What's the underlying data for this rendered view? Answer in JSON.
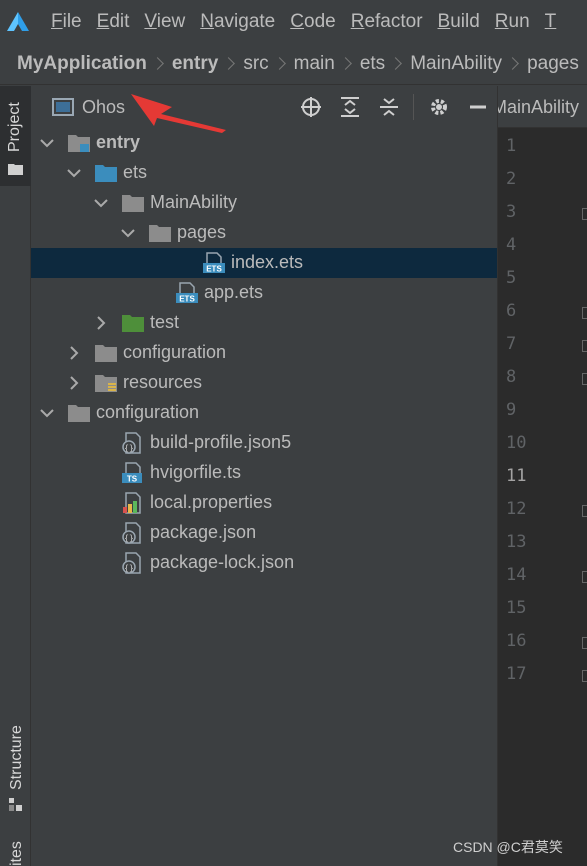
{
  "menu": {
    "items": [
      {
        "mnemonic": "F",
        "rest": "ile"
      },
      {
        "mnemonic": "E",
        "rest": "dit"
      },
      {
        "mnemonic": "V",
        "rest": "iew"
      },
      {
        "mnemonic": "N",
        "rest": "avigate"
      },
      {
        "mnemonic": "C",
        "rest": "ode"
      },
      {
        "mnemonic": "R",
        "rest": "efactor"
      },
      {
        "mnemonic": "B",
        "rest": "uild"
      },
      {
        "mnemonic": "R",
        "rest": "un"
      },
      {
        "mnemonic": "T",
        "rest": ""
      }
    ]
  },
  "breadcrumb": {
    "items": [
      "MyApplication",
      "entry",
      "src",
      "main",
      "ets",
      "MainAbility",
      "pages"
    ]
  },
  "left_strip": {
    "project_tab": "Project",
    "structure_tab": "Structure",
    "bottom_tab": "ites"
  },
  "panel": {
    "title": "Ohos"
  },
  "tree": [
    {
      "label": "entry",
      "icon": "module-folder-icon",
      "expanded": true
    },
    {
      "label": "ets",
      "icon": "source-folder-icon",
      "expanded": true
    },
    {
      "label": "MainAbility",
      "icon": "folder-icon",
      "expanded": true
    },
    {
      "label": "pages",
      "icon": "folder-icon",
      "expanded": true
    },
    {
      "label": "index.ets",
      "icon": "ets-file-icon",
      "selected": true
    },
    {
      "label": "app.ets",
      "icon": "ets-file-icon"
    },
    {
      "label": "test",
      "icon": "test-folder-icon",
      "expanded": false
    },
    {
      "label": "configuration",
      "icon": "folder-icon",
      "expanded": false
    },
    {
      "label": "resources",
      "icon": "resources-folder-icon",
      "expanded": false
    },
    {
      "label": "configuration",
      "icon": "folder-icon",
      "expanded": true
    },
    {
      "label": "build-profile.json5",
      "icon": "json-file-icon"
    },
    {
      "label": "hvigorfile.ts",
      "icon": "ts-file-icon"
    },
    {
      "label": "local.properties",
      "icon": "properties-file-icon"
    },
    {
      "label": "package.json",
      "icon": "json-file-icon"
    },
    {
      "label": "package-lock.json",
      "icon": "json-file-icon"
    }
  ],
  "editor": {
    "tab_label": "MainAbility",
    "line_numbers": [
      "1",
      "2",
      "3",
      "4",
      "5",
      "6",
      "7",
      "8",
      "9",
      "10",
      "11",
      "12",
      "13",
      "14",
      "15",
      "16",
      "17"
    ],
    "current_line": "11"
  },
  "watermark": "CSDN @C君莫笑",
  "colors": {
    "accent_arrow": "#e53935",
    "selection": "#0d293e",
    "folder": "#8c8c8c",
    "source_folder": "#3b8dbd",
    "test_folder": "#4e8f3a"
  }
}
